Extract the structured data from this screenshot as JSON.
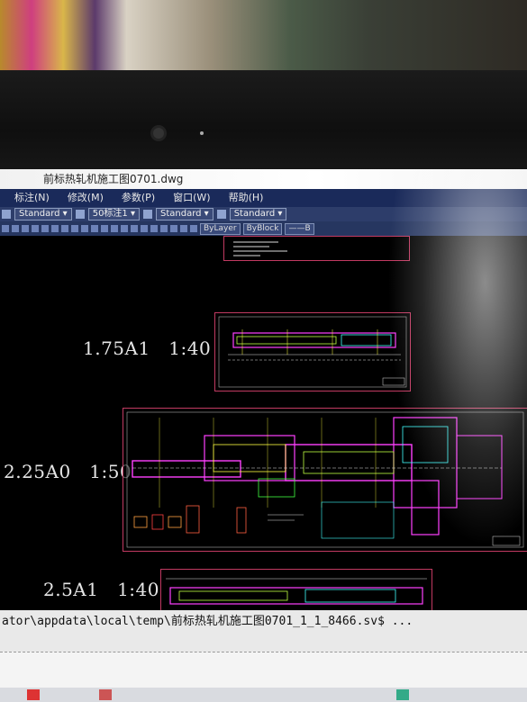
{
  "window": {
    "title": "前标热轧机施工图0701.dwg"
  },
  "menu": [
    {
      "label": "标注(N)",
      "name": "menu-dimension"
    },
    {
      "label": "修改(M)",
      "name": "menu-modify"
    },
    {
      "label": "参数(P)",
      "name": "menu-parametric"
    },
    {
      "label": "窗口(W)",
      "name": "menu-window"
    },
    {
      "label": "帮助(H)",
      "name": "menu-help"
    }
  ],
  "toolbar": {
    "text_style": "Standard",
    "dim_style": "50标注1",
    "table_style": "Standard",
    "multileader_style": "Standard"
  },
  "layers": {
    "color": "ByLayer",
    "linetype": "ByBlock",
    "lineweight": "——B"
  },
  "canvas": {
    "labels": [
      {
        "size": "1.75A1",
        "scale": "1:40"
      },
      {
        "size": "2.25A0",
        "scale": "1:50"
      },
      {
        "size": "2.5A1",
        "scale": "1:40"
      }
    ]
  },
  "command_line": {
    "text": "ator\\appdata\\local\\temp\\前标热轧机施工图0701_1_1_8466.sv$ ..."
  }
}
